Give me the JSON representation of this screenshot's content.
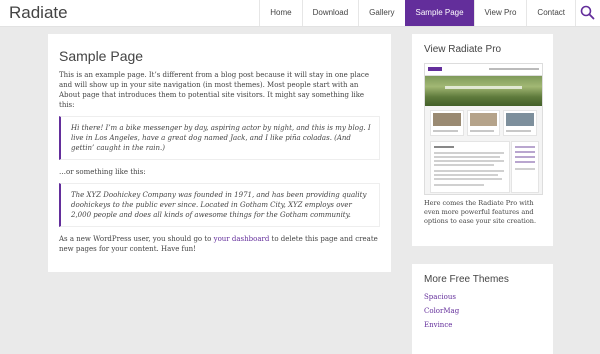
{
  "site": {
    "title": "Radiate"
  },
  "nav": {
    "items": [
      {
        "label": "Home",
        "active": false
      },
      {
        "label": "Download",
        "active": false
      },
      {
        "label": "Gallery",
        "active": false
      },
      {
        "label": "Sample Page",
        "active": true
      },
      {
        "label": "View Pro",
        "active": false
      },
      {
        "label": "Contact",
        "active": false
      }
    ],
    "search_icon": "search-icon"
  },
  "page": {
    "title": "Sample Page",
    "intro": "This is an example page. It’s different from a blog post because it will stay in one place and will show up in your site navigation (in most themes). Most people start with an About page that introduces them to potential site visitors. It might say something like this:",
    "quote1": "Hi there! I’m a bike messenger by day, aspiring actor by night, and this is my blog. I live in Los Angeles, have a great dog named Jack, and I like piña coladas. (And gettin’ caught in the rain.)",
    "or_text": "…or something like this:",
    "quote2": "The XYZ Doohickey Company was founded in 1971, and has been providing quality doohickeys to the public ever since. Located in Gotham City, XYZ employs over 2,000 people and does all kinds of awesome things for the Gotham community.",
    "outro_before": "As a new WordPress user, you should go to ",
    "outro_link": "your dashboard",
    "outro_after": " to delete this page and create new pages for your content. Have fun!"
  },
  "sidebar": {
    "pro": {
      "title": "View Radiate Pro",
      "description": "Here comes the Radiate Pro with even more powerful features and options to ease your site creation."
    },
    "themes": {
      "title": "More Free Themes",
      "items": [
        "Spacious",
        "ColorMag",
        "Envince"
      ]
    }
  },
  "colors": {
    "accent": "#632e9b",
    "background": "#eaeaea"
  }
}
